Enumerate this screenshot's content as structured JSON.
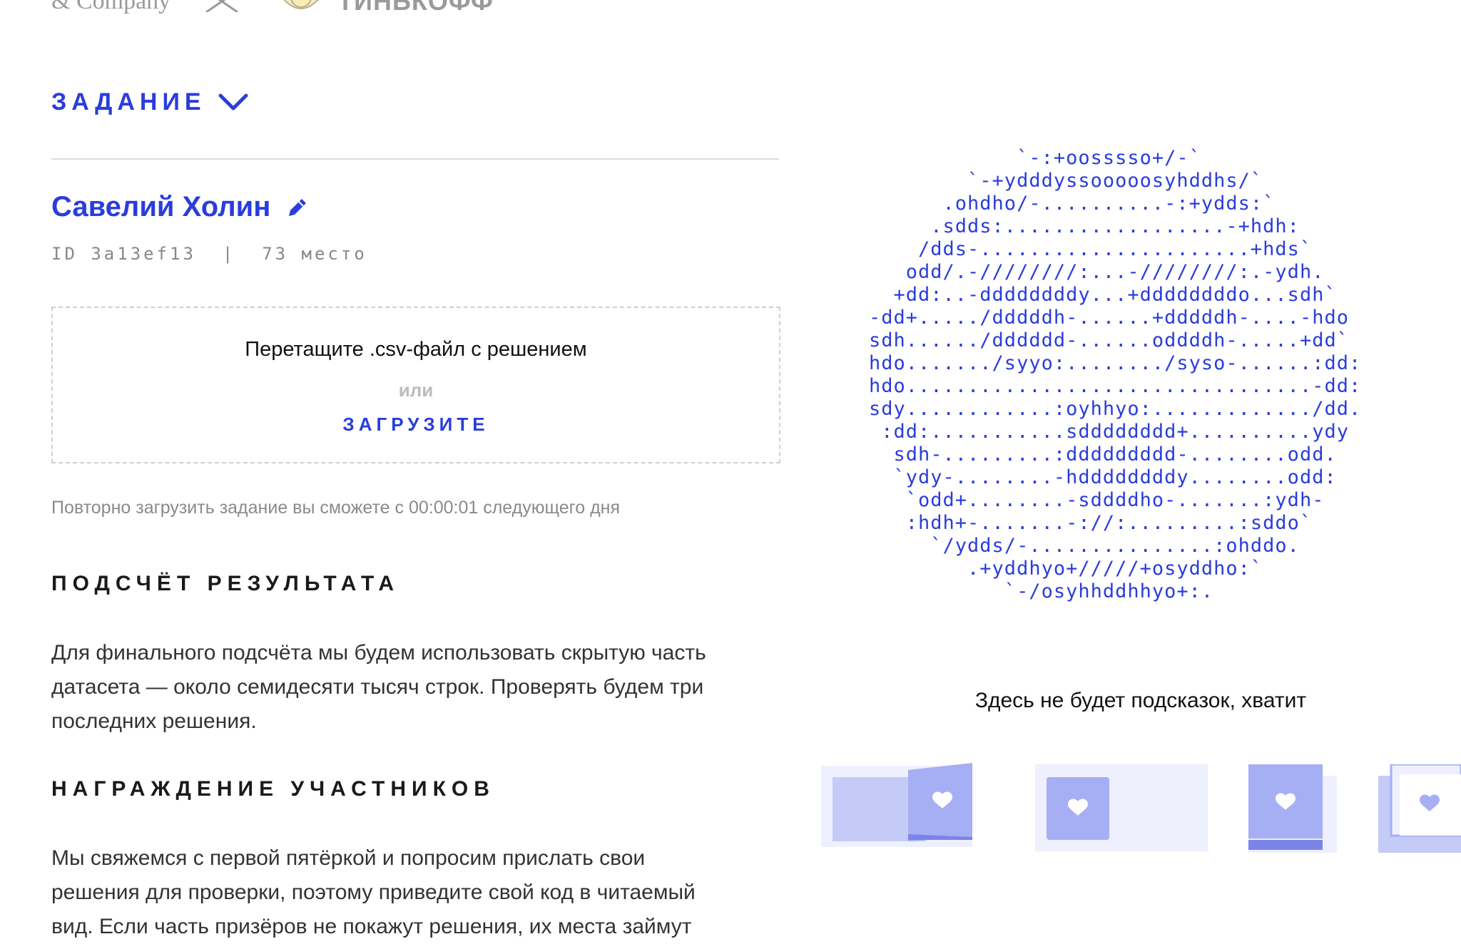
{
  "header": {
    "company_text": "& Company",
    "partner_text": "ТИНЬКОФФ"
  },
  "task_toggle": {
    "label": "ЗАДАНИЕ"
  },
  "user": {
    "name": "Савелий Холин",
    "meta": "ID 3a13ef13  |  73 место"
  },
  "dropzone": {
    "instruction": "Перетащите .csv-файл с решением",
    "or": "или",
    "upload": "ЗАГРУЗИТЕ"
  },
  "upload_note": "Повторно загрузить задание вы сможете с 00:00:01 следующего дня",
  "sections": [
    {
      "title": "ПОДСЧЁТ РЕЗУЛЬТАТА",
      "lines": [
        "Для финального подсчёта мы будем использовать скрытую часть",
        "датасета — около семидесяти тысяч строк. Проверять будем три",
        "последних решения."
      ]
    },
    {
      "title": "НАГРАЖДЕНИЕ УЧАСТНИКОВ",
      "lines": [
        "Мы свяжемся с первой пятёркой и попросим прислать свои",
        "решения для проверки, поэтому приведите свой код в читаемый",
        "вид. Если часть призёров не покажут решения, их места займут"
      ]
    }
  ],
  "ascii_art": [
    "      `-:+oosssso+/-`",
    "    `-+ydddyssooooosyhddhs/`",
    "   .ohdho/-..........-:+ydds:`",
    "  .sdds:..................-+hdh:",
    " /dds-......................+hds`",
    " odd/.-////////:...-////////:.-ydh.",
    "+dd:..-ddddddddy...+ddddddddo...sdh`",
    "-dd+...../dddddh-......+dddddh-....-hdo",
    "sdh....../dddddd-......oddddh-.....+dd`",
    "hdo......./syyo:......../syso-......:dd:",
    "hdo.................................-dd:",
    "sdy............:oyhhyo:............./dd.",
    ":dd:...........sdddddddd+..........ydy",
    " sdh-.........:ddddddddd-........odd.",
    "  `ydy-........-hddddddddy........odd:",
    "   `odd+........-sddddho-.......:ydh-",
    "     :hdh+-.......-://:.........:sddo`",
    "      `/ydds/-...............:ohddo.",
    "        .+yddhyo+/////+osyddho:`",
    "          `-/osyhhddhhyo+:."
  ],
  "hint_text": "Здесь не будет подсказок, хватит",
  "colors": {
    "accent": "#2a3ddb",
    "card_light": "#eef0fd",
    "card_mid": "#c5cbf7",
    "card_strong": "#a6aef4",
    "card_dark": "#7a84e8"
  }
}
